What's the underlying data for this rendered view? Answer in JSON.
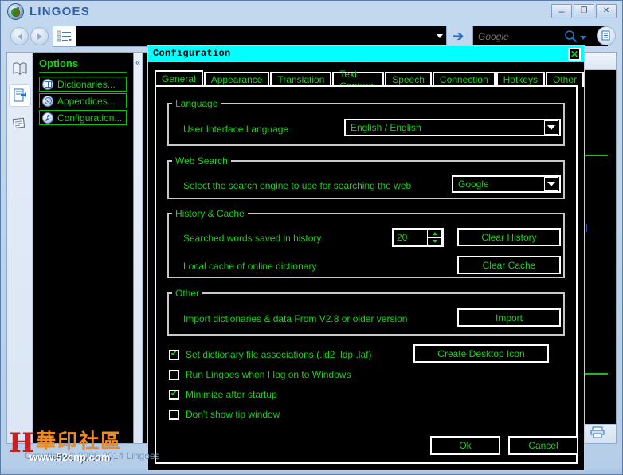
{
  "window": {
    "brand": "LINGOES",
    "logo_icon": "lingoes-parrot-icon",
    "controls": {
      "minimize": "–",
      "maximize": "❐",
      "close": "✕"
    }
  },
  "toolbar": {
    "back_icon": "back-arrow-icon",
    "forward_icon": "forward-arrow-icon",
    "list_icon": "dictionary-list-icon",
    "search_value": "",
    "search_placeholder": "",
    "dropdown_icon": "chevron-down-icon",
    "go_icon": "go-arrow-icon",
    "web_search_value": "",
    "web_search_placeholder": "Google",
    "magnifier_icon": "search-icon",
    "web_caret_icon": "chevron-down-icon",
    "extra_icon": "view-options-icon"
  },
  "rail": {
    "items": [
      {
        "icon": "dictionary-book-icon",
        "active": false
      },
      {
        "icon": "appendices-document-icon",
        "active": true
      },
      {
        "icon": "news-paper-icon",
        "active": false
      }
    ]
  },
  "options_panel": {
    "title": "Options",
    "items": [
      {
        "label": "Dictionaries...",
        "icon": "book-icon"
      },
      {
        "label": "Appendices...",
        "icon": "disc-icon"
      },
      {
        "label": "Configuration...",
        "icon": "wrench-icon"
      }
    ]
  },
  "collapse_handle": {
    "icon": "collapse-left-icon",
    "glyph": "«"
  },
  "right_pane": {
    "footer_icon": "print-preview-icon"
  },
  "watermark": {
    "mark": "H",
    "chinese": "華印社區",
    "url": "www.52cnp.com"
  },
  "copyright": "Copyright © 2006-2014 Lingoes",
  "dialog": {
    "title": "Configuration",
    "close_icon": "close-icon",
    "close_glyph": "✕",
    "tabs": [
      {
        "label": "General",
        "active": true
      },
      {
        "label": "Appearance",
        "active": false
      },
      {
        "label": "Translation",
        "active": false
      },
      {
        "label": "Text Capture",
        "active": false
      },
      {
        "label": "Speech",
        "active": false
      },
      {
        "label": "Connection",
        "active": false
      },
      {
        "label": "Hotkeys",
        "active": false
      },
      {
        "label": "Other",
        "active": false
      }
    ],
    "groups": {
      "language": {
        "legend": "Language",
        "label": "User Interface Language",
        "value": "English  /  English"
      },
      "web_search": {
        "legend": "Web Search",
        "label": "Select the search engine to use for searching the web",
        "value": "Google"
      },
      "history_cache": {
        "legend": "History & Cache",
        "history_label": "Searched words saved in history",
        "history_value": "20",
        "clear_history_button": "Clear History",
        "cache_label": "Local cache of online dictionary",
        "clear_cache_button": "Clear Cache"
      },
      "other": {
        "legend": "Other",
        "label": "Import dictionaries & data From V2.8 or older version",
        "import_button": "Import"
      }
    },
    "checkboxes": [
      {
        "label": "Set dictionary file associations (.ld2 .ldp .laf)",
        "checked": true
      },
      {
        "label": "Run Lingoes when I log on to Windows",
        "checked": false
      },
      {
        "label": "Minimize after startup",
        "checked": true
      },
      {
        "label": "Don't show tip window",
        "checked": false
      }
    ],
    "create_desktop_icon_button": "Create Desktop Icon",
    "ok_button": "Ok",
    "cancel_button": "Cancel"
  },
  "colors": {
    "dialog_titlebar": "#00ffff",
    "green_text": "#19d219",
    "window_chrome": "#bdd4ec",
    "content_bg": "#000000",
    "brand_blue": "#2f5fa8",
    "watermark_orange": "#f08a1e",
    "watermark_red": "#cc2020"
  }
}
